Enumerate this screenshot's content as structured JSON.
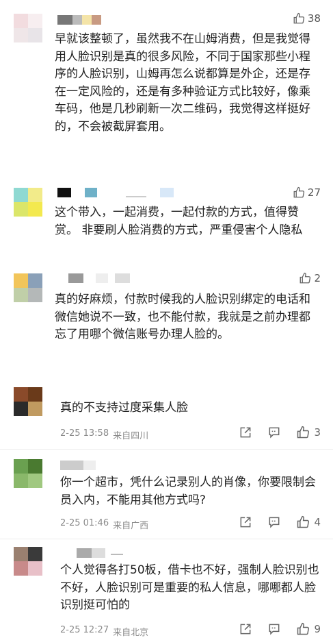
{
  "comments": [
    {
      "text": "早就该整顿了，虽然我不在山姆消费，但是我觉得用人脸识别是真的很多风险，不同于国家那些小程序的人脸识别，山姆再怎么说都算是外企，还是存在一定风险的，还是有多种验证方式比较好，像乘车码，他是几秒刷新一次二维码，我觉得这样挺好的，不会被截屏套用。",
      "likes": "38"
    },
    {
      "text": "这个带入，一起消费，一起付款的方式，值得赞赏。 非要刷人脸消费的方式，严重侵害个人隐私",
      "likes": "27"
    },
    {
      "text": "真的好麻烦，付款时候我的人脸识别绑定的电话和微信她说不一致，也不能付款，我就是之前办理都忘了用哪个微信账号办理人脸的。",
      "likes": "2"
    },
    {
      "text": "真的不支持过度采集人脸",
      "date": "2-25 13:58",
      "location": "来自四川",
      "likes": "3"
    },
    {
      "text": "你一个超市，凭什么记录别人的肖像，你要限制会员入内，不能用其他方式吗?",
      "date": "2-25 01:46",
      "location": "来自广西",
      "likes": "4"
    },
    {
      "text": "个人觉得各打50板，借卡也不好，强制人脸识别也不好，人脸识别可是重要的私人信息，哪哪都人脸识别挺可怕的",
      "date": "2-25 12:27",
      "location": "来自北京",
      "likes": "9"
    }
  ],
  "icons": {
    "like": "thumbs-up-icon",
    "share": "share-edit-icon",
    "reply": "comment-bubble-icon"
  },
  "colors": {
    "text": "#222222",
    "meta": "#8a8a8a",
    "icon": "#666666"
  }
}
